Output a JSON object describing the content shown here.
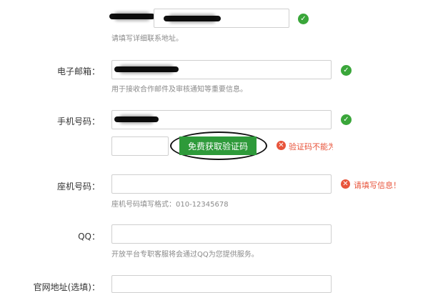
{
  "address": {
    "hint": "请填写详细联系地址。"
  },
  "email": {
    "label": "电子邮箱：",
    "hint": "用于接收合作邮件及审核通知等重要信息。"
  },
  "mobile": {
    "label": "手机号码：",
    "code_button": "免费获取验证码",
    "code_error": "验证码不能为空"
  },
  "landline": {
    "label": "座机号码：",
    "hint": "座机号码填写格式：010-12345678",
    "error": "请填写信息！"
  },
  "qq": {
    "label": "QQ：",
    "hint": "开放平台专职客服将会通过QQ为您提供服务。"
  },
  "website": {
    "label": "官网地址(选填)："
  },
  "icons": {
    "ok": "check-circle-icon",
    "error": "close-circle-icon"
  },
  "colors": {
    "success": "#3aa63a",
    "error": "#e8543b",
    "button": "#2e9a3a"
  }
}
